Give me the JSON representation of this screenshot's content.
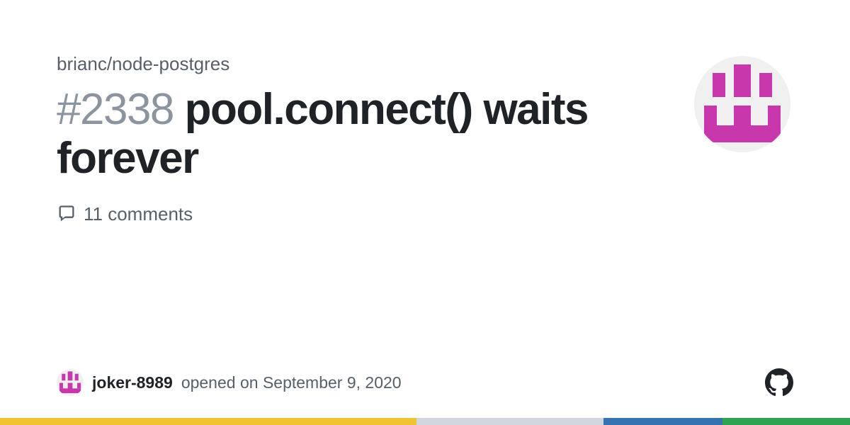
{
  "repo": "brianc/node-postgres",
  "issue": {
    "number": "#2338",
    "title": "pool.connect() waits forever"
  },
  "comments": {
    "count": "11 comments"
  },
  "author": {
    "username": "joker-8989",
    "action": "opened on",
    "date": "September 9, 2020"
  },
  "colors": {
    "identicon": "#c837ab"
  }
}
